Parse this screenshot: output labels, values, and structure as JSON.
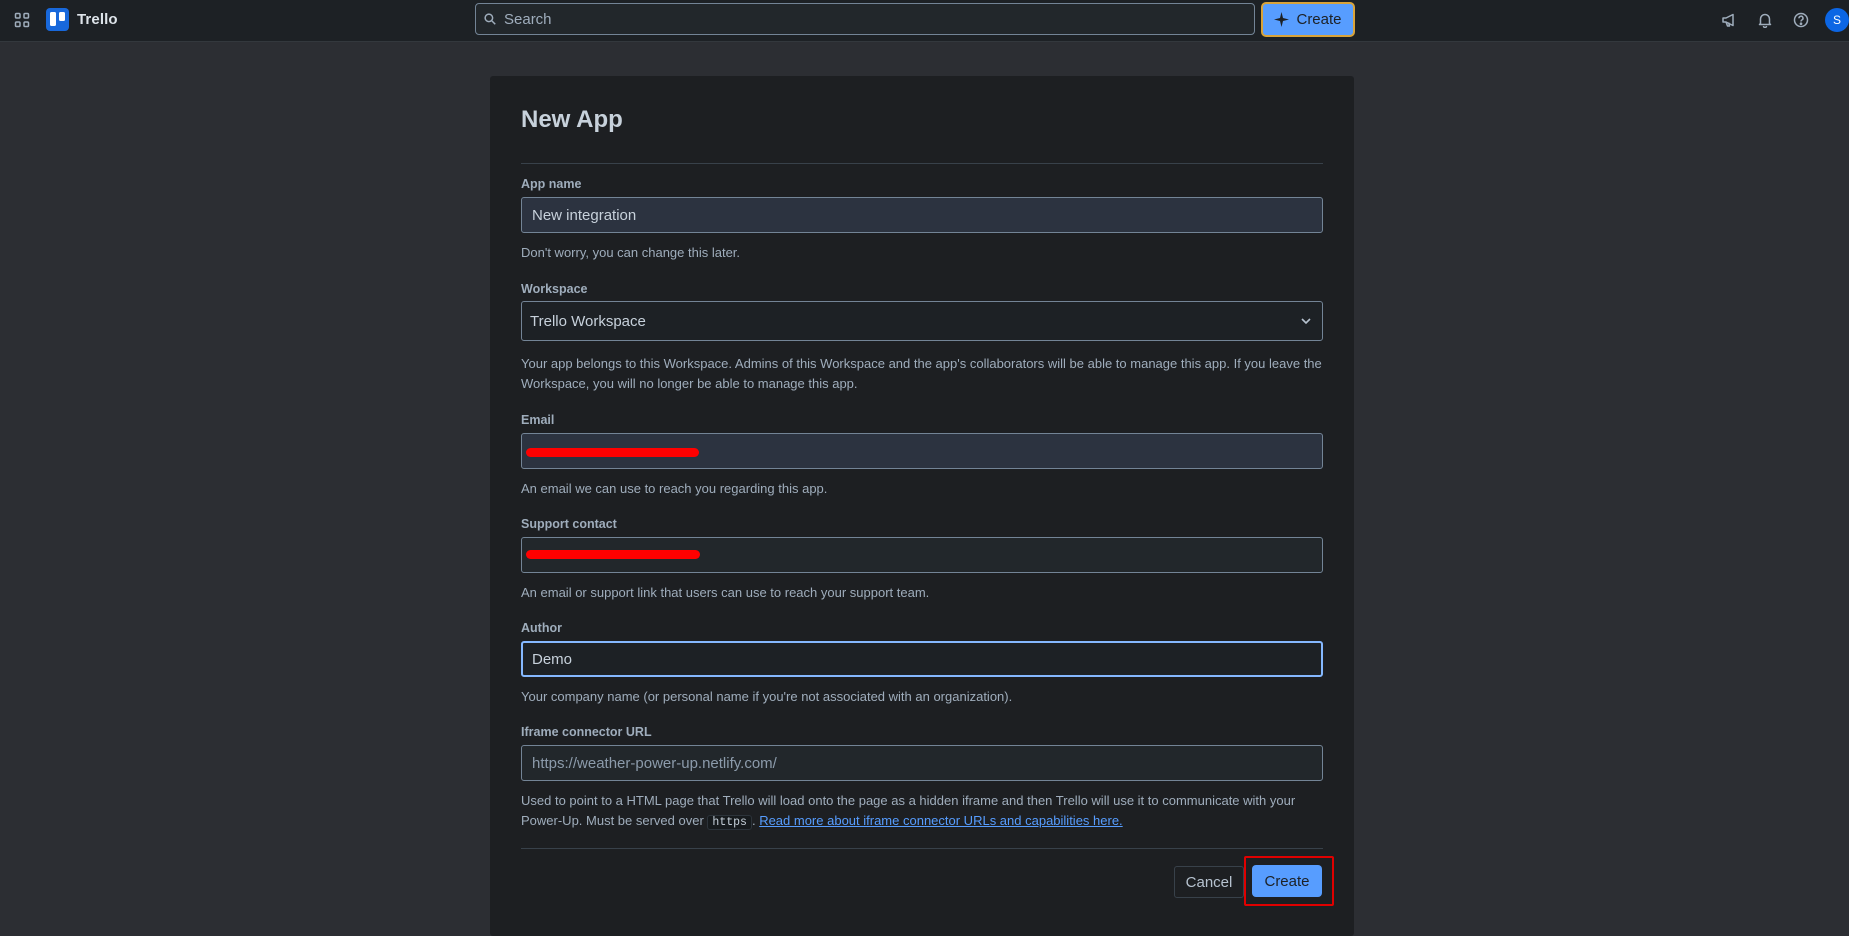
{
  "topbar": {
    "app_name": "Trello",
    "search_placeholder": "Search",
    "create_label": "Create",
    "avatar_initial": "S"
  },
  "form": {
    "title": "New App",
    "app_name": {
      "label": "App name",
      "value": "New integration",
      "help": "Don't worry, you can change this later."
    },
    "workspace": {
      "label": "Workspace",
      "value": "Trello Workspace",
      "help": "Your app belongs to this Workspace. Admins of this Workspace and the app's collaborators will be able to manage this app. If you leave the Workspace, you will no longer be able to manage this app."
    },
    "email": {
      "label": "Email",
      "help": "An email we can use to reach you regarding this app."
    },
    "support": {
      "label": "Support contact",
      "help": "An email or support link that users can use to reach your support team."
    },
    "author": {
      "label": "Author",
      "value": "Demo",
      "help": "Your company name (or personal name if you're not associated with an organization)."
    },
    "iframe": {
      "label": "Iframe connector URL",
      "placeholder": "https://weather-power-up.netlify.com/",
      "help_pre": "Used to point to a HTML page that Trello will load onto the page as a hidden iframe and then Trello will use it to communicate with your Power-Up. Must be served over",
      "help_code": "https",
      "help_sep": ".",
      "help_link": "Read more about iframe connector URLs and capabilities here."
    },
    "cancel_label": "Cancel",
    "create_label": "Create"
  },
  "colors": {
    "accent": "#579dff",
    "brand": "#1868db",
    "highlight": "#e00000"
  }
}
